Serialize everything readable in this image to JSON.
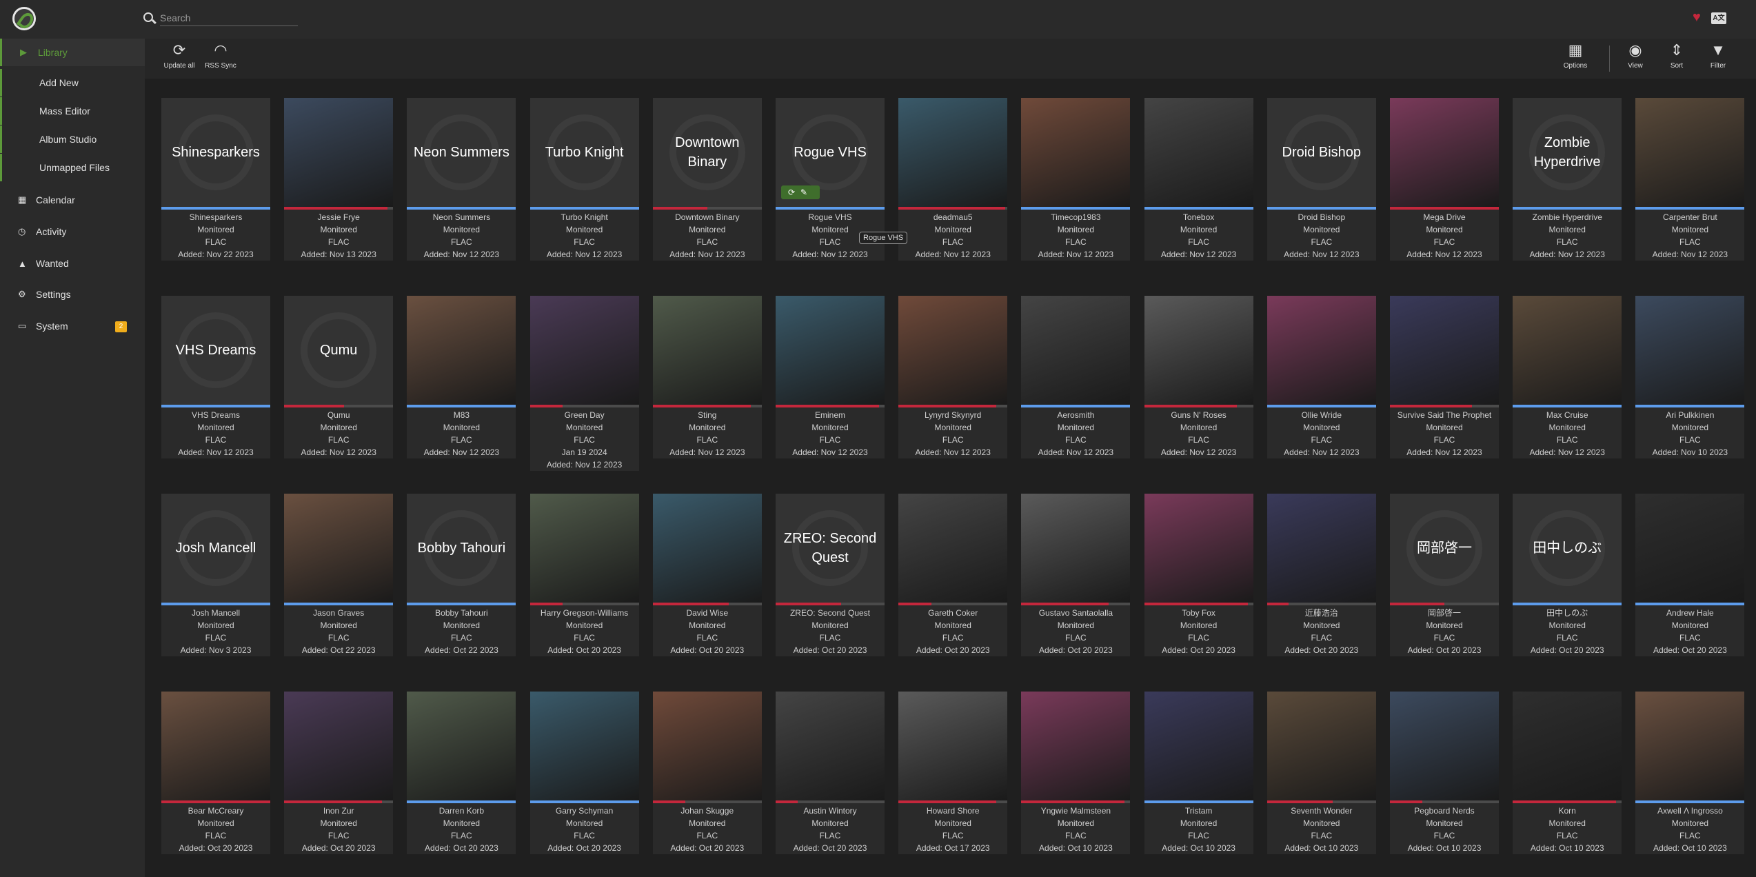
{
  "search": {
    "placeholder": "Search"
  },
  "header": {
    "heart_icon": "heart-icon",
    "translate_icon": "translate-icon"
  },
  "sidebar": {
    "library": "Library",
    "add_new": "Add New",
    "mass_editor": "Mass Editor",
    "album_studio": "Album Studio",
    "unmapped_files": "Unmapped Files",
    "calendar": "Calendar",
    "activity": "Activity",
    "wanted": "Wanted",
    "settings": "Settings",
    "system": "System",
    "system_badge": "2"
  },
  "toolbar": {
    "update_all": "Update all",
    "rss_sync": "RSS Sync",
    "options": "Options",
    "view": "View",
    "sort": "Sort",
    "filter": "Filter"
  },
  "tooltip": "Rogue VHS",
  "colors": {
    "accent": "#5d9a3a",
    "blue": "#5d9cec",
    "red": "#c4273c",
    "gray": "#4b4b4b"
  },
  "artists": [
    {
      "name": "Shinesparkers",
      "placeholder": true,
      "status": "Monitored",
      "quality": "FLAC",
      "added": "Added: Nov 22 2023",
      "bar": "blue",
      "progress": 1.0
    },
    {
      "name": "Jessie Frye",
      "placeholder": false,
      "status": "Monitored",
      "quality": "FLAC",
      "added": "Added: Nov 13 2023",
      "bar": "red",
      "progress": 0.95
    },
    {
      "name": "Neon Summers",
      "placeholder": true,
      "status": "Monitored",
      "quality": "FLAC",
      "added": "Added: Nov 12 2023",
      "bar": "blue",
      "progress": 1.0
    },
    {
      "name": "Turbo Knight",
      "placeholder": true,
      "status": "Monitored",
      "quality": "FLAC",
      "added": "Added: Nov 12 2023",
      "bar": "blue",
      "progress": 1.0
    },
    {
      "name": "Downtown Binary",
      "placeholder": true,
      "status": "Monitored",
      "quality": "FLAC",
      "added": "Added: Nov 12 2023",
      "bar": "red",
      "progress": 0.5
    },
    {
      "name": "Rogue VHS",
      "placeholder": true,
      "status": "Monitored",
      "quality": "FLAC",
      "added": "Added: Nov 12 2023",
      "bar": "blue",
      "progress": 1.0
    },
    {
      "name": "deadmau5",
      "placeholder": false,
      "status": "Monitored",
      "quality": "FLAC",
      "added": "Added: Nov 12 2023",
      "bar": "red",
      "progress": 0.98
    },
    {
      "name": "Timecop1983",
      "placeholder": false,
      "status": "Monitored",
      "quality": "FLAC",
      "added": "Added: Nov 12 2023",
      "bar": "blue",
      "progress": 1.0
    },
    {
      "name": "Tonebox",
      "placeholder": false,
      "status": "Monitored",
      "quality": "FLAC",
      "added": "Added: Nov 12 2023",
      "bar": "blue",
      "progress": 1.0
    },
    {
      "name": "Droid Bishop",
      "placeholder": true,
      "status": "Monitored",
      "quality": "FLAC",
      "added": "Added: Nov 12 2023",
      "bar": "blue",
      "progress": 1.0
    },
    {
      "name": "Mega Drive",
      "placeholder": false,
      "status": "Monitored",
      "quality": "FLAC",
      "added": "Added: Nov 12 2023",
      "bar": "red",
      "progress": 1.0
    },
    {
      "name": "Zombie Hyperdrive",
      "placeholder": true,
      "status": "Monitored",
      "quality": "FLAC",
      "added": "Added: Nov 12 2023",
      "bar": "blue",
      "progress": 1.0
    },
    {
      "name": "Carpenter Brut",
      "placeholder": false,
      "status": "Monitored",
      "quality": "FLAC",
      "added": "Added: Nov 12 2023",
      "bar": "blue",
      "progress": 1.0
    },
    {
      "name": "VHS Dreams",
      "placeholder": true,
      "status": "Monitored",
      "quality": "FLAC",
      "added": "Added: Nov 12 2023",
      "bar": "blue",
      "progress": 1.0
    },
    {
      "name": "Qumu",
      "placeholder": true,
      "status": "Monitored",
      "quality": "FLAC",
      "added": "Added: Nov 12 2023",
      "bar": "red",
      "progress": 0.55
    },
    {
      "name": "M83",
      "placeholder": false,
      "status": "Monitored",
      "quality": "FLAC",
      "added": "Added: Nov 12 2023",
      "bar": "blue",
      "progress": 1.0
    },
    {
      "name": "Green Day",
      "placeholder": false,
      "status": "Monitored",
      "quality": "FLAC",
      "extra": "Jan 19 2024",
      "added": "Added: Nov 12 2023",
      "bar": "red",
      "progress": 0.3
    },
    {
      "name": "Sting",
      "placeholder": false,
      "status": "Monitored",
      "quality": "FLAC",
      "added": "Added: Nov 12 2023",
      "bar": "red",
      "progress": 0.9
    },
    {
      "name": "Eminem",
      "placeholder": false,
      "status": "Monitored",
      "quality": "FLAC",
      "added": "Added: Nov 12 2023",
      "bar": "red",
      "progress": 0.95
    },
    {
      "name": "Lynyrd Skynyrd",
      "placeholder": false,
      "status": "Monitored",
      "quality": "FLAC",
      "added": "Added: Nov 12 2023",
      "bar": "red",
      "progress": 0.9
    },
    {
      "name": "Aerosmith",
      "placeholder": false,
      "status": "Monitored",
      "quality": "FLAC",
      "added": "Added: Nov 12 2023",
      "bar": "blue",
      "progress": 1.0
    },
    {
      "name": "Guns N' Roses",
      "placeholder": false,
      "status": "Monitored",
      "quality": "FLAC",
      "added": "Added: Nov 12 2023",
      "bar": "red",
      "progress": 0.85
    },
    {
      "name": "Ollie Wride",
      "placeholder": false,
      "status": "Monitored",
      "quality": "FLAC",
      "added": "Added: Nov 12 2023",
      "bar": "blue",
      "progress": 1.0
    },
    {
      "name": "Survive Said The Prophet",
      "placeholder": false,
      "status": "Monitored",
      "quality": "FLAC",
      "added": "Added: Nov 12 2023",
      "bar": "red",
      "progress": 0.75
    },
    {
      "name": "Max Cruise",
      "placeholder": false,
      "status": "Monitored",
      "quality": "FLAC",
      "added": "Added: Nov 12 2023",
      "bar": "blue",
      "progress": 1.0
    },
    {
      "name": "Ari Pulkkinen",
      "placeholder": false,
      "status": "Monitored",
      "quality": "FLAC",
      "added": "Added: Nov 10 2023",
      "bar": "blue",
      "progress": 1.0
    },
    {
      "name": "Josh Mancell",
      "placeholder": true,
      "status": "Monitored",
      "quality": "FLAC",
      "added": "Added: Nov 3 2023",
      "bar": "blue",
      "progress": 1.0
    },
    {
      "name": "Jason Graves",
      "placeholder": false,
      "status": "Monitored",
      "quality": "FLAC",
      "added": "Added: Oct 22 2023",
      "bar": "blue",
      "progress": 1.0
    },
    {
      "name": "Bobby Tahouri",
      "placeholder": true,
      "status": "Monitored",
      "quality": "FLAC",
      "added": "Added: Oct 22 2023",
      "bar": "blue",
      "progress": 1.0
    },
    {
      "name": "Harry Gregson-Williams",
      "placeholder": false,
      "status": "Monitored",
      "quality": "FLAC",
      "added": "Added: Oct 20 2023",
      "bar": "red",
      "progress": 0.3
    },
    {
      "name": "David Wise",
      "placeholder": false,
      "status": "Monitored",
      "quality": "FLAC",
      "added": "Added: Oct 20 2023",
      "bar": "red",
      "progress": 0.7
    },
    {
      "name": "ZREO: Second Quest",
      "placeholder": true,
      "status": "Monitored",
      "quality": "FLAC",
      "added": "Added: Oct 20 2023",
      "bar": "red",
      "progress": 0.6
    },
    {
      "name": "Gareth Coker",
      "placeholder": false,
      "status": "Monitored",
      "quality": "FLAC",
      "added": "Added: Oct 20 2023",
      "bar": "red",
      "progress": 0.3
    },
    {
      "name": "Gustavo Santaolalla",
      "placeholder": false,
      "status": "Monitored",
      "quality": "FLAC",
      "added": "Added: Oct 20 2023",
      "bar": "red",
      "progress": 0.8
    },
    {
      "name": "Toby Fox",
      "placeholder": false,
      "status": "Monitored",
      "quality": "FLAC",
      "added": "Added: Oct 20 2023",
      "bar": "red",
      "progress": 0.95
    },
    {
      "name": "近藤浩治",
      "placeholder": false,
      "status": "Monitored",
      "quality": "FLAC",
      "added": "Added: Oct 20 2023",
      "bar": "red",
      "progress": 0.2
    },
    {
      "name": "岡部啓一",
      "placeholder": true,
      "status": "Monitored",
      "quality": "FLAC",
      "added": "Added: Oct 20 2023",
      "bar": "red",
      "progress": 0.5
    },
    {
      "name": "田中しのぶ",
      "placeholder": true,
      "status": "Monitored",
      "quality": "FLAC",
      "added": "Added: Oct 20 2023",
      "bar": "blue",
      "progress": 1.0
    },
    {
      "name": "Andrew Hale",
      "placeholder": false,
      "status": "Monitored",
      "quality": "FLAC",
      "added": "Added: Oct 20 2023",
      "bar": "blue",
      "progress": 1.0
    },
    {
      "name": "Bear McCreary",
      "placeholder": false,
      "status": "Monitored",
      "quality": "FLAC",
      "added": "Added: Oct 20 2023",
      "bar": "red",
      "progress": 1.0
    },
    {
      "name": "Inon Zur",
      "placeholder": false,
      "status": "Monitored",
      "quality": "FLAC",
      "added": "Added: Oct 20 2023",
      "bar": "red",
      "progress": 0.9
    },
    {
      "name": "Darren Korb",
      "placeholder": false,
      "status": "Monitored",
      "quality": "FLAC",
      "added": "Added: Oct 20 2023",
      "bar": "blue",
      "progress": 1.0
    },
    {
      "name": "Garry Schyman",
      "placeholder": false,
      "status": "Monitored",
      "quality": "FLAC",
      "added": "Added: Oct 20 2023",
      "bar": "blue",
      "progress": 1.0
    },
    {
      "name": "Johan Skugge",
      "placeholder": false,
      "status": "Monitored",
      "quality": "FLAC",
      "added": "Added: Oct 20 2023",
      "bar": "red",
      "progress": 0.3
    },
    {
      "name": "Austin Wintory",
      "placeholder": false,
      "status": "Monitored",
      "quality": "FLAC",
      "added": "Added: Oct 20 2023",
      "bar": "red",
      "progress": 0.2
    },
    {
      "name": "Howard Shore",
      "placeholder": false,
      "status": "Monitored",
      "quality": "FLAC",
      "added": "Added: Oct 17 2023",
      "bar": "red",
      "progress": 0.9
    },
    {
      "name": "Yngwie Malmsteen",
      "placeholder": false,
      "status": "Monitored",
      "quality": "FLAC",
      "added": "Added: Oct 10 2023",
      "bar": "red",
      "progress": 0.95
    },
    {
      "name": "Tristam",
      "placeholder": false,
      "status": "Monitored",
      "quality": "FLAC",
      "added": "Added: Oct 10 2023",
      "bar": "blue",
      "progress": 1.0
    },
    {
      "name": "Seventh Wonder",
      "placeholder": false,
      "status": "Monitored",
      "quality": "FLAC",
      "added": "Added: Oct 10 2023",
      "bar": "red",
      "progress": 0.6
    },
    {
      "name": "Pegboard Nerds",
      "placeholder": false,
      "status": "Monitored",
      "quality": "FLAC",
      "added": "Added: Oct 10 2023",
      "bar": "red",
      "progress": 0.3
    },
    {
      "name": "Korn",
      "placeholder": false,
      "status": "Monitored",
      "quality": "FLAC",
      "added": "Added: Oct 10 2023",
      "bar": "red",
      "progress": 0.95
    },
    {
      "name": "Axwell Λ Ingrosso",
      "placeholder": false,
      "status": "Monitored",
      "quality": "FLAC",
      "added": "Added: Oct 10 2023",
      "bar": "blue",
      "progress": 1.0
    }
  ]
}
